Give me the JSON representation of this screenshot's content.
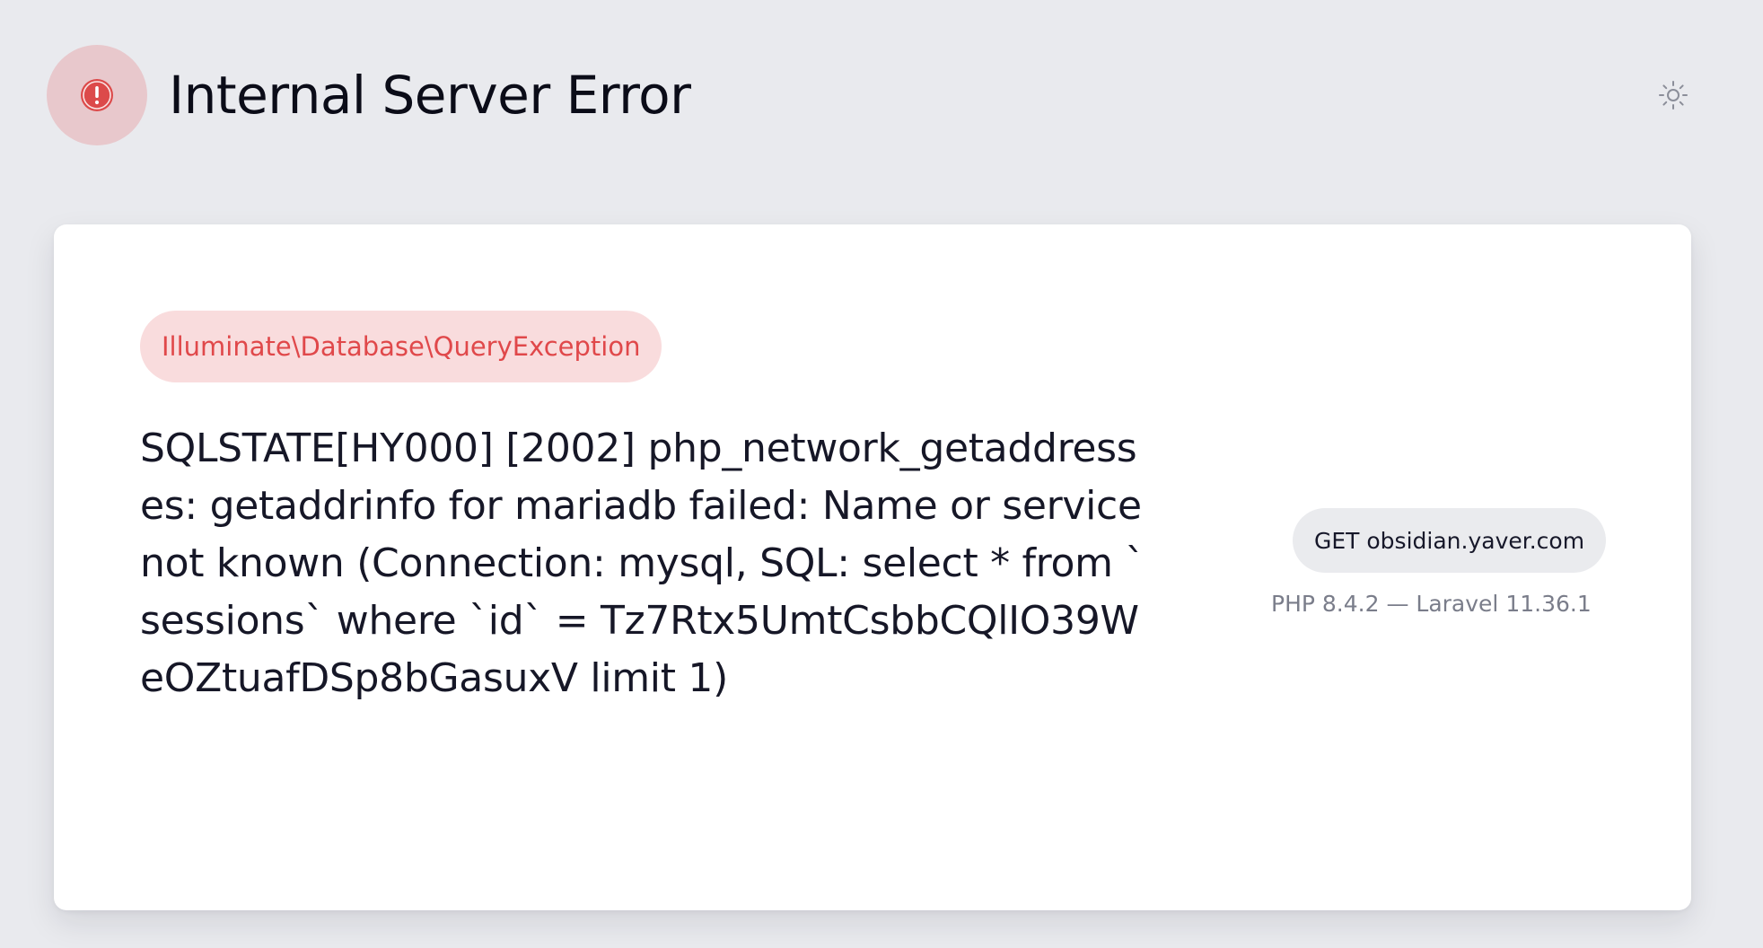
{
  "header": {
    "title": "Internal Server Error",
    "status_icon": "exclamation-circle-icon",
    "theme_icon": "sun-icon"
  },
  "exception": {
    "class": "Illuminate\\Database\\QueryException",
    "message": "SQLSTATE[HY000] [2002] php_network_getaddresses: getaddrinfo for mariadb failed: Name or service not known (Connection: mysql, SQL: select * from `sessions` where `id` = Tz7Rtx5UmtCsbbCQlIO39WeOZtuafDSp8bGasuxV limit 1)"
  },
  "request": {
    "label": "GET obsidian.yaver.com"
  },
  "versions": {
    "label": "PHP 8.4.2 — Laravel 11.36.1"
  },
  "colors": {
    "background": "#e9eaee",
    "card": "#ffffff",
    "error_accent": "#dc4a4a",
    "error_badge_bg": "#e8c8cc",
    "exception_pill_bg": "#f9dcdd",
    "exception_pill_text": "#e0484a"
  }
}
